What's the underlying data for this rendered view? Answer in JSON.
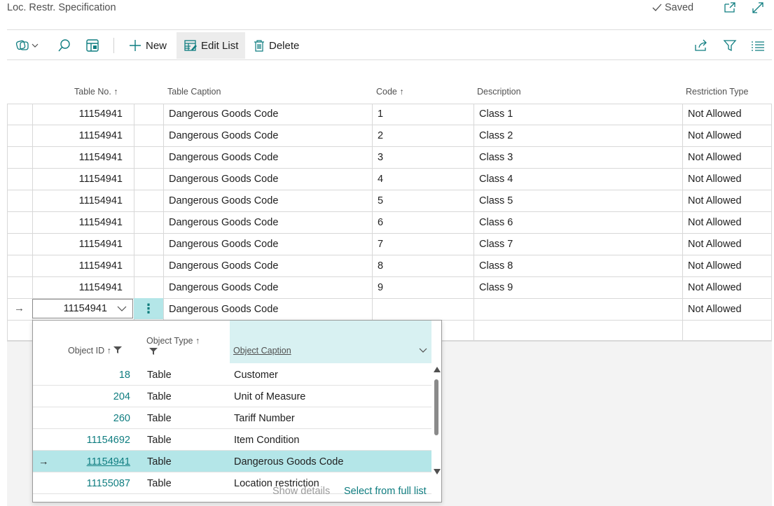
{
  "header": {
    "title": "Loc. Restr. Specification",
    "saved_label": "Saved"
  },
  "actionbar": {
    "new_label": "New",
    "edit_list_label": "Edit List",
    "delete_label": "Delete"
  },
  "columns": {
    "table_no": "Table No.",
    "table_caption": "Table Caption",
    "code": "Code",
    "description": "Description",
    "restriction_type": "Restriction Type"
  },
  "rows": [
    {
      "table_no": "11154941",
      "caption": "Dangerous Goods Code",
      "code": "1",
      "description": "Class 1",
      "restriction": "Not Allowed"
    },
    {
      "table_no": "11154941",
      "caption": "Dangerous Goods Code",
      "code": "2",
      "description": "Class 2",
      "restriction": "Not Allowed"
    },
    {
      "table_no": "11154941",
      "caption": "Dangerous Goods Code",
      "code": "3",
      "description": "Class 3",
      "restriction": "Not Allowed"
    },
    {
      "table_no": "11154941",
      "caption": "Dangerous Goods Code",
      "code": "4",
      "description": "Class 4",
      "restriction": "Not Allowed"
    },
    {
      "table_no": "11154941",
      "caption": "Dangerous Goods Code",
      "code": "5",
      "description": "Class 5",
      "restriction": "Not Allowed"
    },
    {
      "table_no": "11154941",
      "caption": "Dangerous Goods Code",
      "code": "6",
      "description": "Class 6",
      "restriction": "Not Allowed"
    },
    {
      "table_no": "11154941",
      "caption": "Dangerous Goods Code",
      "code": "7",
      "description": "Class 7",
      "restriction": "Not Allowed"
    },
    {
      "table_no": "11154941",
      "caption": "Dangerous Goods Code",
      "code": "8",
      "description": "Class 8",
      "restriction": "Not Allowed"
    },
    {
      "table_no": "11154941",
      "caption": "Dangerous Goods Code",
      "code": "9",
      "description": "Class 9",
      "restriction": "Not Allowed"
    }
  ],
  "edit_row": {
    "table_no": "11154941",
    "caption": "Dangerous Goods Code",
    "restriction": "Not Allowed"
  },
  "lookup": {
    "col_object_id": "Object ID",
    "col_object_type": "Object Type",
    "col_object_caption": "Object Caption",
    "items": [
      {
        "id": "18",
        "type": "Table",
        "caption": "Customer"
      },
      {
        "id": "204",
        "type": "Table",
        "caption": "Unit of Measure"
      },
      {
        "id": "260",
        "type": "Table",
        "caption": "Tariff Number"
      },
      {
        "id": "11154692",
        "type": "Table",
        "caption": "Item Condition"
      },
      {
        "id": "11154941",
        "type": "Table",
        "caption": "Dangerous Goods Code"
      },
      {
        "id": "11155087",
        "type": "Table",
        "caption": "Location restriction"
      }
    ],
    "show_details": "Show details",
    "select_full_list": "Select from full list"
  },
  "colors": {
    "accent": "#0f7d80",
    "selection": "#b4e6e8",
    "caption_header": "#d8f1f2"
  }
}
